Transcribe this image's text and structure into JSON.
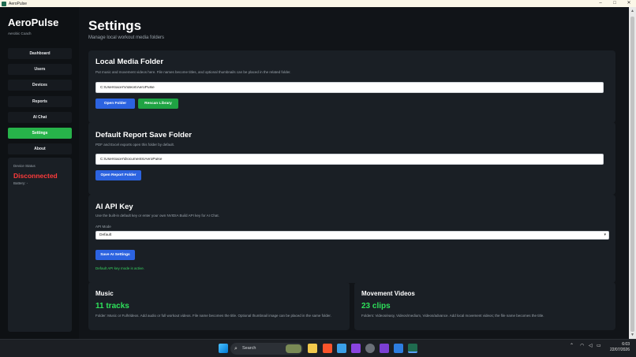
{
  "window": {
    "title": "AeroPulse",
    "minimize": "–",
    "maximize": "□",
    "close": "✕"
  },
  "sidebar": {
    "brand": "AeroPulse",
    "subtitle": "Aerobic Coach",
    "nav": [
      {
        "label": "Dashboard"
      },
      {
        "label": "Users"
      },
      {
        "label": "Devices"
      },
      {
        "label": "Reports"
      },
      {
        "label": "AI Chat"
      },
      {
        "label": "Settings",
        "active": true
      },
      {
        "label": "About"
      }
    ],
    "device": {
      "label": "Device Status",
      "status": "Disconnected",
      "battery": "Battery: -"
    }
  },
  "page": {
    "title": "Settings",
    "subtitle": "Manage local workout media folders"
  },
  "media_folder": {
    "title": "Local Media Folder",
    "description": "Put music and movement videos here. File names become titles, and optional thumbnails can be placed in the related folder.",
    "path": "C:\\Users\\acer\\Videos\\AeroPulse",
    "open_button": "Open Folder",
    "rescan_button": "Rescan Library"
  },
  "report_folder": {
    "title": "Default Report Save Folder",
    "description": "PDF and Excel exports open this folder by default.",
    "path": "C:\\Users\\acer\\Documents\\AeroPulse",
    "open_button": "Open Report Folder"
  },
  "ai_api": {
    "title": "AI API Key",
    "description": "Use the built-in default key or enter your own NVIDIA Build API key for AI Chat.",
    "mode_label": "API Mode",
    "mode_value": "Default",
    "save_button": "Save AI Settings",
    "status": "Default API key mode is active."
  },
  "music": {
    "title": "Music",
    "count": "11 tracks",
    "description": "Folder: Music or FullVideos. Add audio or full workout videos. File name becomes the title. Optional thumbnail image can be placed in the same folder."
  },
  "movement": {
    "title": "Movement Videos",
    "count": "23 clips",
    "description": "Folders: Videos/easy, Videos/medium, Videos/advance. Add local movement videos; the file name becomes the title."
  },
  "taskbar": {
    "search_placeholder": "Search",
    "time": "6:03",
    "date": "22/07/2026"
  },
  "colors": {
    "accent_green": "#27b34a",
    "primary_blue": "#2c63e0",
    "error_red": "#ff3b3b",
    "success_green": "#2ee05a"
  }
}
